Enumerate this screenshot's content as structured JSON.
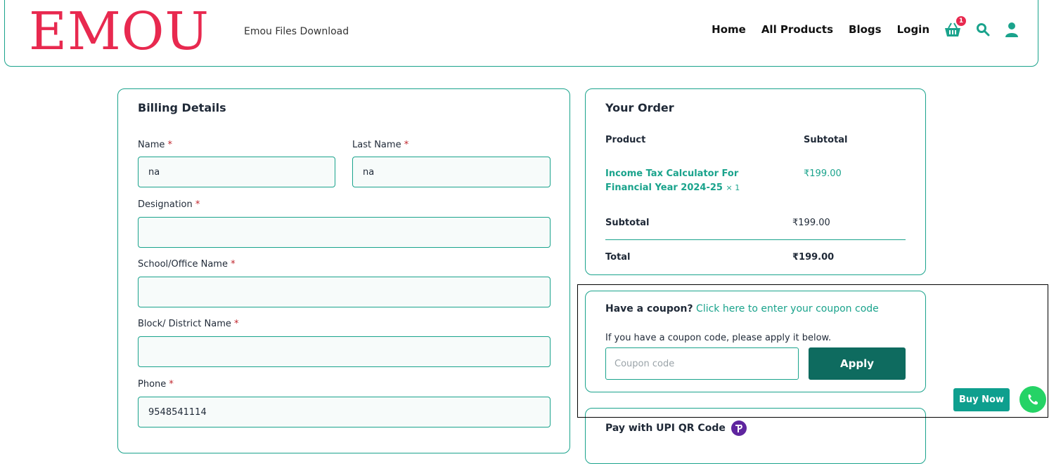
{
  "header": {
    "logo": "EMOU",
    "site_desc": "Emou Files Download",
    "nav": [
      "Home",
      "All Products",
      "Blogs",
      "Login"
    ],
    "cart_count": "1",
    "icons": [
      "cart-icon",
      "search-icon",
      "user-icon"
    ]
  },
  "billing": {
    "title": "Billing Details",
    "fields": [
      {
        "label": "Name",
        "req": "*",
        "value": "na"
      },
      {
        "label": "Last Name",
        "req": "*",
        "value": "na"
      },
      {
        "label": "Designation",
        "req": "*",
        "value": ""
      },
      {
        "label": "School/Office Name",
        "req": "*",
        "value": ""
      },
      {
        "label": "Block/ District Name",
        "req": "*",
        "value": ""
      },
      {
        "label": "Phone",
        "req": "*",
        "value": "9548541114"
      }
    ]
  },
  "order": {
    "title": "Your Order",
    "col_product": "Product",
    "col_subtotal": "Subtotal",
    "item_name_line1": "Income Tax Calculator For",
    "item_name_line2": "Financial Year 2024-25",
    "item_qty": "× 1",
    "item_price": "₹199.00",
    "subtotal_label": "Subtotal",
    "subtotal_value": "₹199.00",
    "total_label": "Total",
    "total_value": "₹199.00"
  },
  "coupon": {
    "prompt": "Have a coupon?",
    "link": "Click here to enter your coupon code",
    "hint": "If you have a coupon code, please apply it below.",
    "placeholder": "Coupon code",
    "apply_label": "Apply"
  },
  "payment": {
    "title": "Pay with UPI QR Code",
    "icon": "phonepe-icon"
  },
  "floating": {
    "buy_now": "Buy Now",
    "whatsapp_icon": "whatsapp-icon"
  },
  "colors": {
    "brand": "#e8294f",
    "accent": "#1aa38c",
    "dark_teal": "#0e6b5f",
    "upi_purple": "#5f259f"
  }
}
